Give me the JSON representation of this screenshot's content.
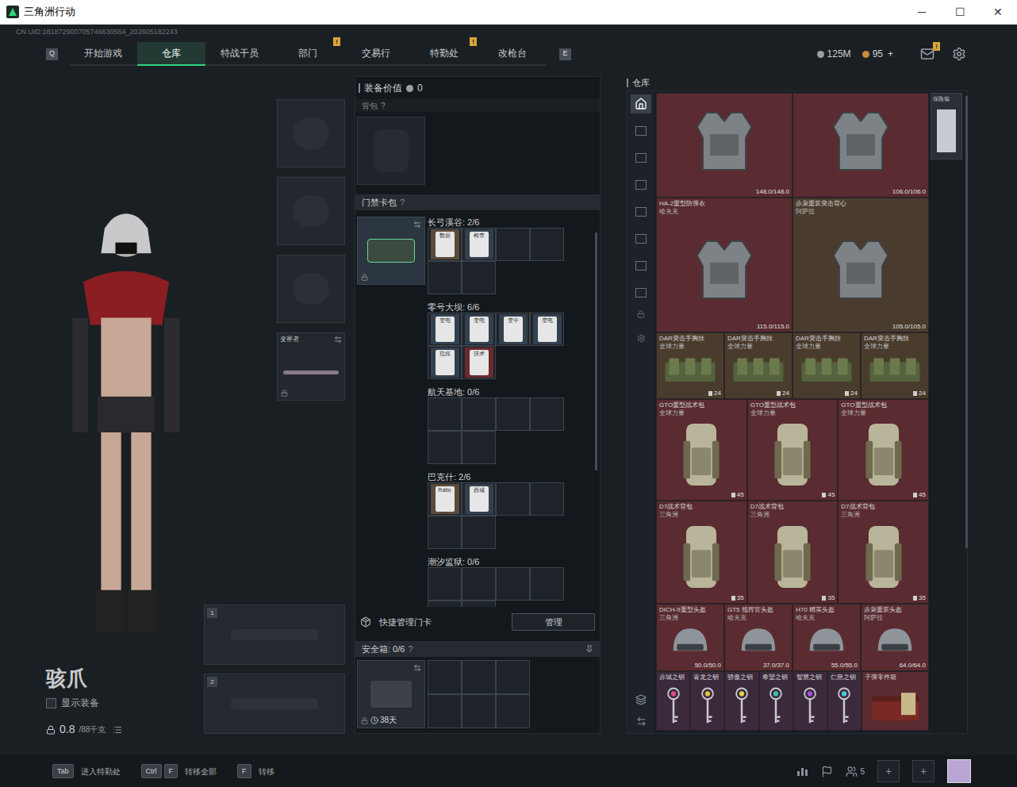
{
  "window": {
    "title": "三角洲行动",
    "controls": [
      "─",
      "☐",
      "✕"
    ]
  },
  "uid": "CN UID:181872900705746630564_202605182243",
  "nav": {
    "left_key": "Q",
    "right_key": "E",
    "tabs": [
      {
        "label": "开始游戏",
        "selected": false,
        "badge": ""
      },
      {
        "label": "仓库",
        "selected": true,
        "badge": ""
      },
      {
        "label": "特战干员",
        "selected": false,
        "badge": ""
      },
      {
        "label": "部门",
        "selected": false,
        "badge": "!"
      },
      {
        "label": "交易行",
        "selected": false,
        "badge": ""
      },
      {
        "label": "特勤处",
        "selected": false,
        "badge": "!"
      },
      {
        "label": "改枪台",
        "selected": false,
        "badge": ""
      }
    ]
  },
  "currency": [
    {
      "amount": "125M",
      "add": ""
    },
    {
      "amount": "95",
      "add": "+"
    }
  ],
  "mail_badge": "!",
  "operator": {
    "name": "骇爪",
    "show_equipment": {
      "label": "显示装备",
      "checked": false
    },
    "weight": "0.8",
    "weight_max": "/88千克"
  },
  "gear_slots": [
    {
      "kind": "helmet",
      "label": "",
      "locked": false
    },
    {
      "kind": "armor",
      "label": "",
      "locked": false
    },
    {
      "kind": "pistol",
      "label": "",
      "locked": false
    },
    {
      "kind": "melee",
      "label": "变星者",
      "locked": true
    }
  ],
  "weapon_slots": [
    "1",
    "2"
  ],
  "loadout": {
    "value_label": "装备价值",
    "value": "0",
    "backpack_label": "背包",
    "help": "?",
    "keycard_label": "门禁卡包",
    "maps": [
      {
        "name": "长弓溪谷: 2/6",
        "slots": 6,
        "cards": [
          {
            "label": "数据",
            "color": "#5b4a3a"
          },
          {
            "label": "检查",
            "color": "#33404e"
          }
        ]
      },
      {
        "name": "零号大坝: 6/6",
        "slots": 6,
        "cards": [
          {
            "label": "变电",
            "color": "#33404e"
          },
          {
            "label": "变电",
            "color": "#33404e"
          },
          {
            "label": "变中",
            "color": "#33404e"
          },
          {
            "label": "变电",
            "color": "#33404e"
          },
          {
            "label": "指挥",
            "color": "#33404e"
          },
          {
            "label": "技术",
            "color": "#6a2a2e"
          }
        ]
      },
      {
        "name": "航天基地: 0/6",
        "slots": 6,
        "cards": []
      },
      {
        "name": "巴克什: 2/6",
        "slots": 6,
        "cards": [
          {
            "label": "Ratio",
            "color": "#5b4a3a"
          },
          {
            "label": "西城",
            "color": "#33404e"
          }
        ]
      },
      {
        "name": "潮汐监狱: 0/6",
        "slots": 6,
        "cards": []
      }
    ],
    "quick_manage": "快捷管理门卡",
    "manage_button": "管理",
    "safe_box": {
      "label": "安全箱: 0/6",
      "time": "38天",
      "slots": 6
    }
  },
  "warehouse": {
    "label": "仓库",
    "side_item": "保险箱",
    "tabs": [
      {
        "selected": true
      },
      {
        "selected": false
      },
      {
        "selected": false
      },
      {
        "selected": false
      },
      {
        "selected": false
      },
      {
        "selected": false
      },
      {
        "selected": false
      },
      {
        "selected": false
      }
    ],
    "rows": [
      [
        {
          "kind": "armor",
          "name": "",
          "brand": "",
          "value": "148.0/148.0",
          "count": "",
          "color": "#5a2b30"
        },
        {
          "kind": "armor",
          "name": "",
          "brand": "",
          "value": "106.0/106.0",
          "count": "",
          "color": "#5a2b30"
        }
      ],
      [
        {
          "kind": "armor",
          "name": "HA-2重型防弹衣",
          "brand": "哈夫克",
          "value": "115.0/115.0",
          "count": "",
          "color": "#5a2b30"
        },
        {
          "kind": "armor",
          "name": "赤枭重装突击背心",
          "brand": "阿萨拉",
          "value": "105.0/105.0",
          "count": "",
          "color": "#4a3c2d"
        }
      ],
      [
        {
          "kind": "rig",
          "name": "DAR突击手胸挂",
          "brand": "全球力量",
          "value": "",
          "count": "24",
          "color": "#4a3c2d"
        },
        {
          "kind": "rig",
          "name": "DAR突击手胸挂",
          "brand": "全球力量",
          "value": "",
          "count": "24",
          "color": "#4a3c2d"
        },
        {
          "kind": "rig",
          "name": "DAR突击手胸挂",
          "brand": "全球力量",
          "value": "",
          "count": "24",
          "color": "#4a3c2d"
        },
        {
          "kind": "rig",
          "name": "DAR突击手胸挂",
          "brand": "全球力量",
          "value": "",
          "count": "24",
          "color": "#4a3c2d"
        }
      ],
      [
        {
          "kind": "backpack",
          "name": "GTO重型战术包",
          "brand": "全球力量",
          "value": "",
          "count": "45",
          "color": "#5a2b30"
        },
        {
          "kind": "backpack",
          "name": "GTO重型战术包",
          "brand": "全球力量",
          "value": "",
          "count": "45",
          "color": "#5a2b30"
        },
        {
          "kind": "backpack",
          "name": "GTO重型战术包",
          "brand": "全球力量",
          "value": "",
          "count": "45",
          "color": "#5a2b30"
        }
      ],
      [
        {
          "kind": "backpack",
          "name": "D7战术背包",
          "brand": "三角洲",
          "value": "",
          "count": "35",
          "color": "#5a2b30"
        },
        {
          "kind": "backpack",
          "name": "D7战术背包",
          "brand": "三角洲",
          "value": "",
          "count": "35",
          "color": "#5a2b30"
        },
        {
          "kind": "backpack",
          "name": "D7战术背包",
          "brand": "三角洲",
          "value": "",
          "count": "35",
          "color": "#5a2b30"
        }
      ],
      [
        {
          "kind": "helmet",
          "name": "DICH-9重型头盔",
          "brand": "三角洲",
          "value": "50.0/50.0",
          "count": "",
          "color": "#5a2b30"
        },
        {
          "kind": "helmet",
          "name": "GT5 指挥官头盔",
          "brand": "哈夫克",
          "value": "37.0/37.0",
          "count": "",
          "color": "#5a2b30"
        },
        {
          "kind": "helmet",
          "name": "H70 精英头盔",
          "brand": "哈夫克",
          "value": "55.0/55.0",
          "count": "",
          "color": "#5a2b30"
        },
        {
          "kind": "helmet",
          "name": "赤枭重装头盔",
          "brand": "阿萨拉",
          "value": "64.0/64.0",
          "count": "",
          "color": "#5a2b30"
        }
      ],
      [
        {
          "kind": "key",
          "name": "赤城之钥",
          "brand": "",
          "value": "",
          "count": "",
          "color": "#e04a86"
        },
        {
          "kind": "key",
          "name": "青龙之钥",
          "brand": "",
          "value": "",
          "count": "",
          "color": "#e0c040"
        },
        {
          "kind": "key",
          "name": "骄傲之钥",
          "brand": "",
          "value": "",
          "count": "",
          "color": "#e0d050"
        },
        {
          "kind": "key",
          "name": "希望之钥",
          "brand": "",
          "value": "",
          "count": "",
          "color": "#40c0b0"
        },
        {
          "kind": "key",
          "name": "智慧之钥",
          "brand": "",
          "value": "",
          "count": "",
          "color": "#a050e0"
        },
        {
          "kind": "key",
          "name": "仁慈之钥",
          "brand": "",
          "value": "",
          "count": "",
          "color": "#50c8e0"
        },
        {
          "kind": "box",
          "name": "子弹零件箱",
          "brand": "",
          "value": "",
          "count": "",
          "color": "#5a2b30"
        }
      ]
    ]
  },
  "hints": [
    {
      "keys": [
        "Tab"
      ],
      "label": "进入特勤处"
    },
    {
      "keys": [
        "Ctrl",
        "F"
      ],
      "label": "转移全部"
    },
    {
      "keys": [
        "F"
      ],
      "label": "转移"
    }
  ],
  "friends": "5",
  "add_slots": [
    "+",
    "+"
  ]
}
